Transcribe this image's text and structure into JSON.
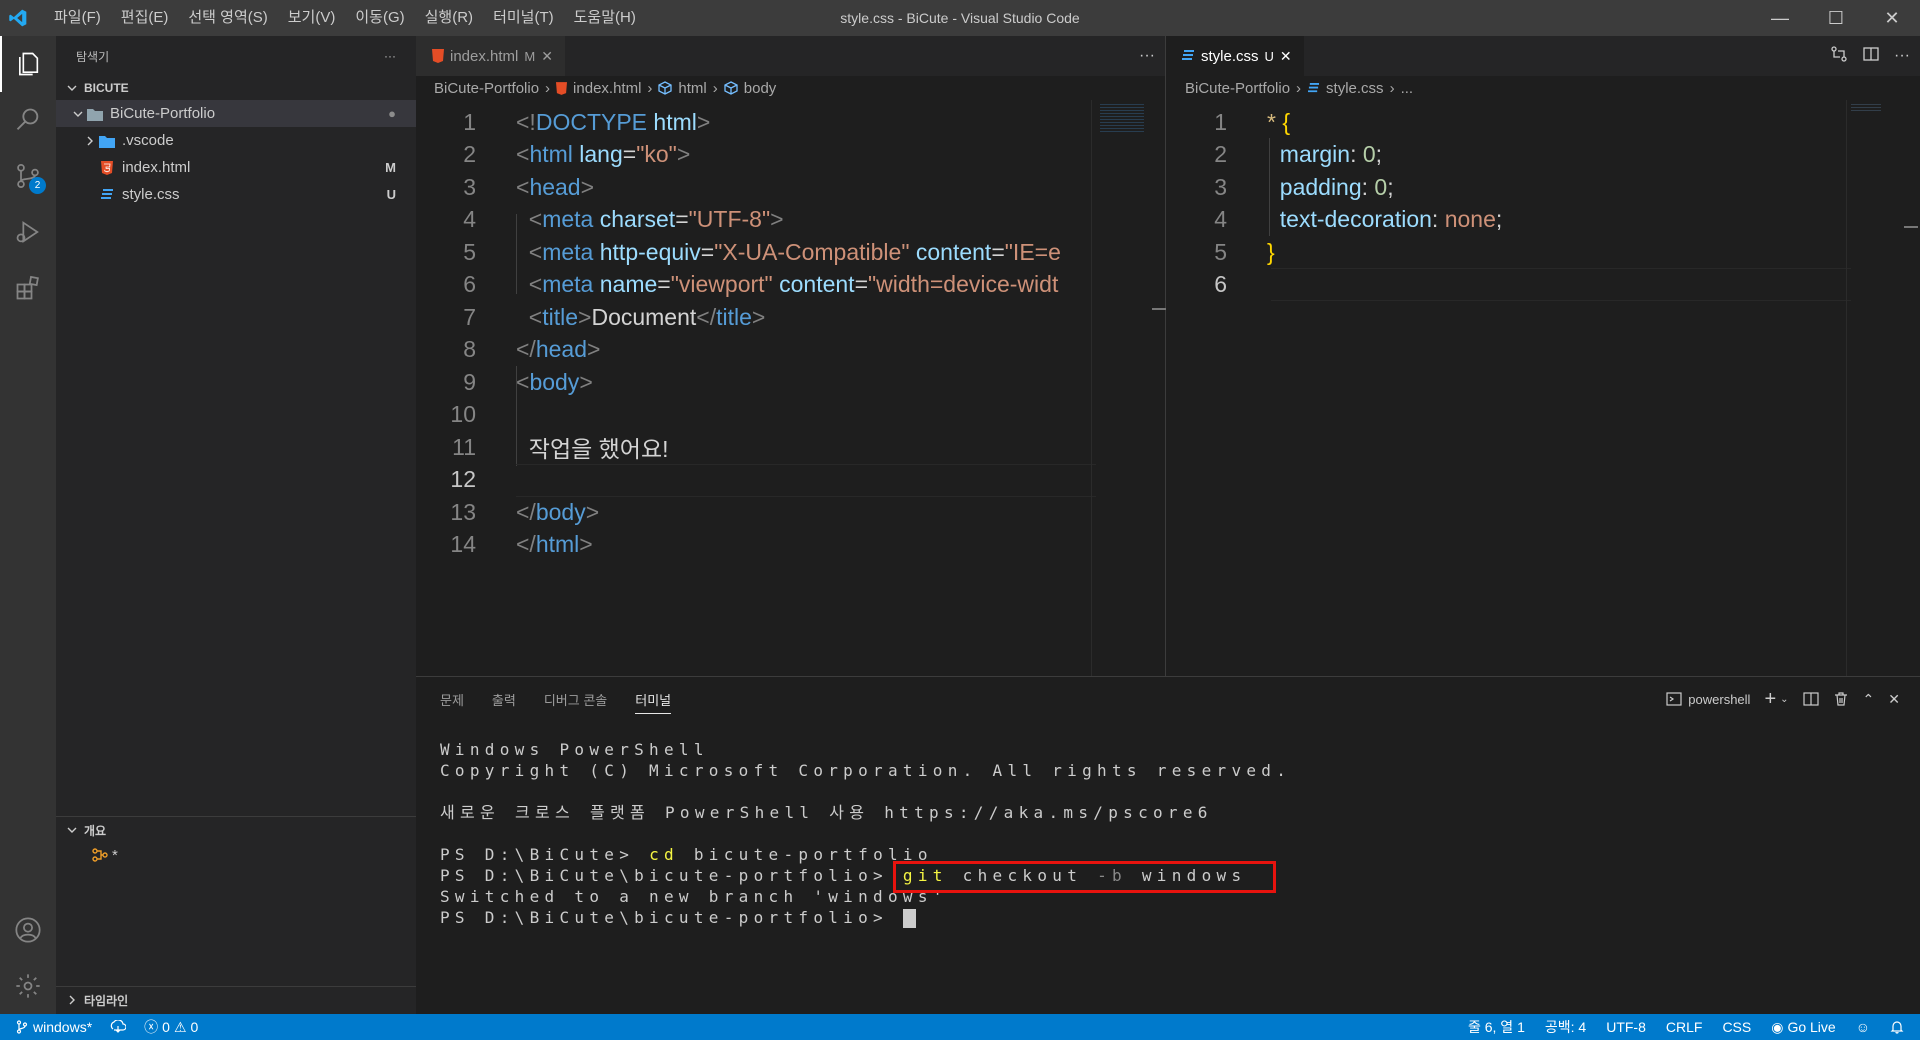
{
  "titlebar": {
    "title": "style.css - BiCute - Visual Studio Code",
    "menu": [
      "파일(F)",
      "편집(E)",
      "선택 영역(S)",
      "보기(V)",
      "이동(G)",
      "실행(R)",
      "터미널(T)",
      "도움말(H)"
    ],
    "controls": {
      "minimize": "—",
      "maximize": "☐",
      "close": "✕"
    }
  },
  "activity": {
    "scm_badge": "2"
  },
  "sidebar": {
    "title": "탐색기",
    "more": "···",
    "section": "BICUTE",
    "folder": "BiCute-Portfolio",
    "items": [
      {
        "label": ".vscode",
        "status": ""
      },
      {
        "label": "index.html",
        "status": "M"
      },
      {
        "label": "style.css",
        "status": "U"
      }
    ],
    "outline_title": "개요",
    "outline_item": "*",
    "timeline_title": "타임라인"
  },
  "editor_left": {
    "tab_label": "index.html",
    "tab_status": "M",
    "more": "···",
    "breadcrumb": [
      "BiCute-Portfolio",
      "index.html",
      "html",
      "body"
    ],
    "line_numbers": [
      "1",
      "2",
      "3",
      "4",
      "5",
      "6",
      "7",
      "8",
      "9",
      "10",
      "11",
      "12",
      "13",
      "14"
    ],
    "lines": {
      "l1_tag": "DOCTYPE",
      "l1_attr": "html",
      "l2_tag": "html",
      "l2_attr": "lang",
      "l2_val": "\"ko\"",
      "l3_tag": "head",
      "l4_tag": "meta",
      "l4_attr": "charset",
      "l4_val": "\"UTF-8\"",
      "l5_tag": "meta",
      "l5_attr": "http-equiv",
      "l5_val": "\"X-UA-Compatible\"",
      "l5_attr2": "content",
      "l5_val2": "\"IE=e",
      "l6_tag": "meta",
      "l6_attr": "name",
      "l6_val": "\"viewport\"",
      "l6_attr2": "content",
      "l6_val2": "\"width=device-widt",
      "l7_tag": "title",
      "l7_text": "Document",
      "l8_tag": "head",
      "l9_tag": "body",
      "l11_text": "작업을 했어요!",
      "l13_tag": "body",
      "l14_tag": "html"
    }
  },
  "editor_right": {
    "tab_label": "style.css",
    "tab_status": "U",
    "tab_close": "✕",
    "breadcrumb": [
      "BiCute-Portfolio",
      "style.css",
      "..."
    ],
    "line_numbers": [
      "1",
      "2",
      "3",
      "4",
      "5",
      "6"
    ],
    "lines": {
      "selector": "*",
      "open": "{",
      "p1": "margin",
      "v1": "0",
      "p2": "padding",
      "v2": "0",
      "p3": "text-decoration",
      "v3": "none",
      "close": "}"
    }
  },
  "panel": {
    "tabs": [
      "문제",
      "출력",
      "디버그 콘솔",
      "터미널"
    ],
    "active_tab": "터미널",
    "shell": "powershell",
    "terminal": {
      "l1": "Windows PowerShell",
      "l2": "Copyright (C) Microsoft Corporation. All rights reserved.",
      "l3": "새로운 크로스 플랫폼 PowerShell 사용 https://aka.ms/pscore6",
      "l4_prompt": "PS D:\\BiCute> ",
      "l4_cmd": "cd",
      "l4_arg": " bicute-portfolio",
      "l5_prompt": "PS D:\\BiCute\\bicute-portfolio> ",
      "l5_cmd": "git",
      "l5_arg1": " checkout ",
      "l5_flag": "-b",
      "l5_arg2": " windows",
      "l6": "Switched to a new branch 'windows'",
      "l7_prompt": "PS D:\\BiCute\\bicute-portfolio> "
    }
  },
  "statusbar": {
    "branch": "windows*",
    "errors": "0",
    "warnings": "0",
    "position": "줄 6, 열 1",
    "spaces": "공백: 4",
    "encoding": "UTF-8",
    "eol": "CRLF",
    "language": "CSS",
    "golive": "Go Live"
  },
  "colors": {
    "accent": "#007acc",
    "highlight_box": "#e8130e"
  }
}
